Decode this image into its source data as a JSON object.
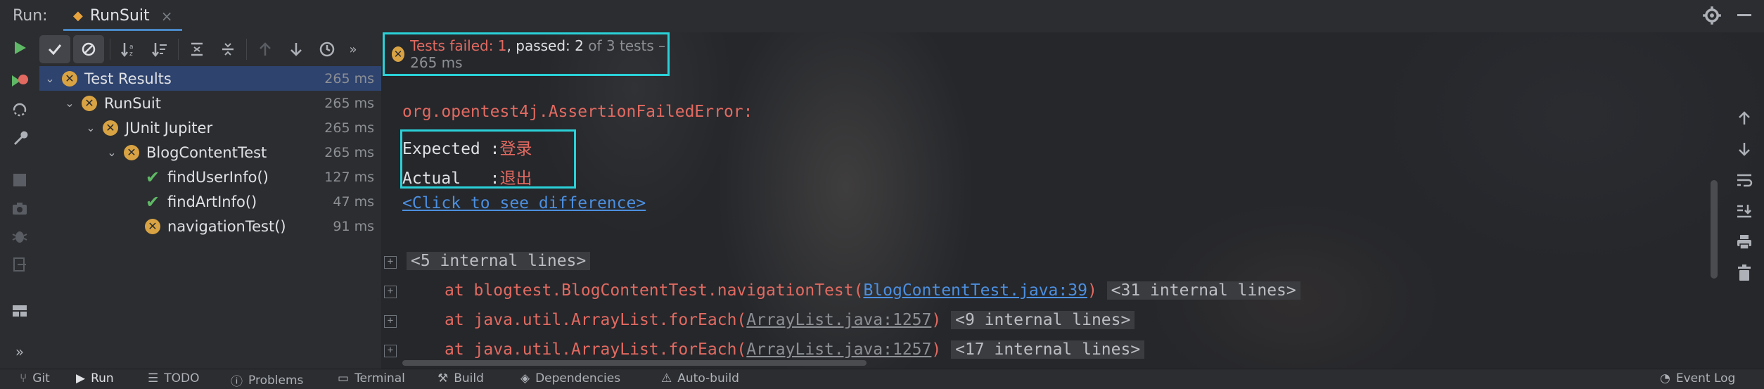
{
  "header": {
    "title": "Run:",
    "tab_label": "RunSuit",
    "tab_close": "×"
  },
  "summary": {
    "failed": "Tests failed: 1",
    "sep": ",",
    "passed": " passed: 2",
    "rest": " of 3 tests – 265 ms"
  },
  "tree": {
    "items": [
      {
        "label": "Test Results",
        "time": "265 ms",
        "status": "fail"
      },
      {
        "label": "RunSuit",
        "time": "265 ms",
        "status": "fail"
      },
      {
        "label": "JUnit Jupiter",
        "time": "265 ms",
        "status": "fail"
      },
      {
        "label": "BlogContentTest",
        "time": "265 ms",
        "status": "fail"
      },
      {
        "label": "findUserInfo()",
        "time": "127 ms",
        "status": "pass"
      },
      {
        "label": "findArtInfo()",
        "time": "47 ms",
        "status": "pass"
      },
      {
        "label": "navigationTest()",
        "time": "91 ms",
        "status": "fail"
      }
    ]
  },
  "console": {
    "error_class": "org.opentest4j.AssertionFailedError:",
    "expected_label": "Expected :",
    "expected_value": "登录",
    "actual_label": "Actual   :",
    "actual_value": "退出",
    "diff_link": "<Click to see difference>",
    "internal1": "<5 internal lines>",
    "trace1_prefix": "at blogtest.BlogContentTest.navigationTest(",
    "trace1_link": "BlogContentTest.java:39",
    "trace1_suffix": ")",
    "trace1_internal": "<31 internal lines>",
    "trace2_prefix": "at java.util.ArrayList.forEach(",
    "trace2_link": "ArrayList.java:1257",
    "trace2_suffix": ")",
    "trace2_internal": "<9 internal lines>",
    "trace3_prefix": "at java.util.ArrayList.forEach(",
    "trace3_link": "ArrayList.java:1257",
    "trace3_suffix": ")",
    "trace3_internal": "<17 internal lines>"
  },
  "bottom_bar": {
    "tabs": [
      "Git",
      "Run",
      "TODO",
      "Problems",
      "Terminal",
      "Build",
      "Dependencies",
      "Auto-build"
    ],
    "right": "Event Log"
  },
  "colors": {
    "accent": "#4a88c7",
    "highlight_box": "#2ad1d8",
    "fail": "#d9a343",
    "pass": "#5fb865",
    "error_text": "#e26a61"
  }
}
